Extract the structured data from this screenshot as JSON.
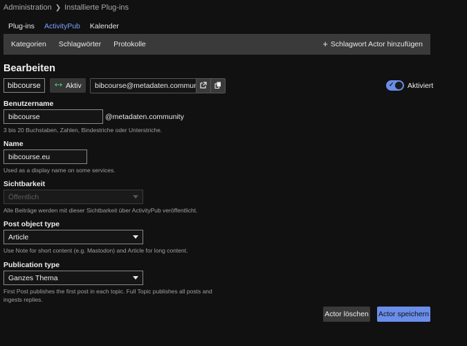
{
  "breadcrumb": {
    "root": "Administration",
    "current": "Installierte Plug-ins"
  },
  "tabs": [
    {
      "label": "Plug-ins",
      "active": false
    },
    {
      "label": "ActivityPub",
      "active": true
    },
    {
      "label": "Kalender",
      "active": false
    }
  ],
  "subnav": {
    "items": [
      "Kategorien",
      "Schlagwörter",
      "Protokolle"
    ],
    "add_label": "Schlagwort Actor hinzufügen"
  },
  "page_title": "Bearbeiten",
  "actor": {
    "name": "bibcourse",
    "status_icon": "activitypub-icon",
    "status_label": "Aktiv",
    "handle": "bibcourse@metadaten.community",
    "enabled": true,
    "enabled_label": "Aktiviert"
  },
  "fields": {
    "username": {
      "label": "Benutzername",
      "value": "bibcourse",
      "suffix": "@metadaten.community",
      "help": "3 bis 20 Buchstaben, Zahlen, Bindestriche oder Unterstriche."
    },
    "name": {
      "label": "Name",
      "value": "bibcourse.eu",
      "help": "Used as a display name on some services."
    },
    "visibility": {
      "label": "Sichtbarkeit",
      "value": "Öffentlich",
      "help": "Alle Beiträge werden mit dieser Sichtbarkeit über ActivityPub veröffentlicht."
    },
    "post_object_type": {
      "label": "Post object type",
      "value": "Article",
      "help": "Use Note for short content (e.g. Mastodon) and Article for long content."
    },
    "publication_type": {
      "label": "Publication type",
      "value": "Ganzes Thema",
      "help_line1": "First Post publishes the first post in each topic. Full Topic publishes all posts and",
      "help_line2": "ingests replies."
    }
  },
  "buttons": {
    "delete": "Actor löschen",
    "save": "Actor speichern"
  },
  "colors": {
    "accent": "#6b8eea",
    "background": "#111111",
    "panel": "#3a3a3a"
  }
}
